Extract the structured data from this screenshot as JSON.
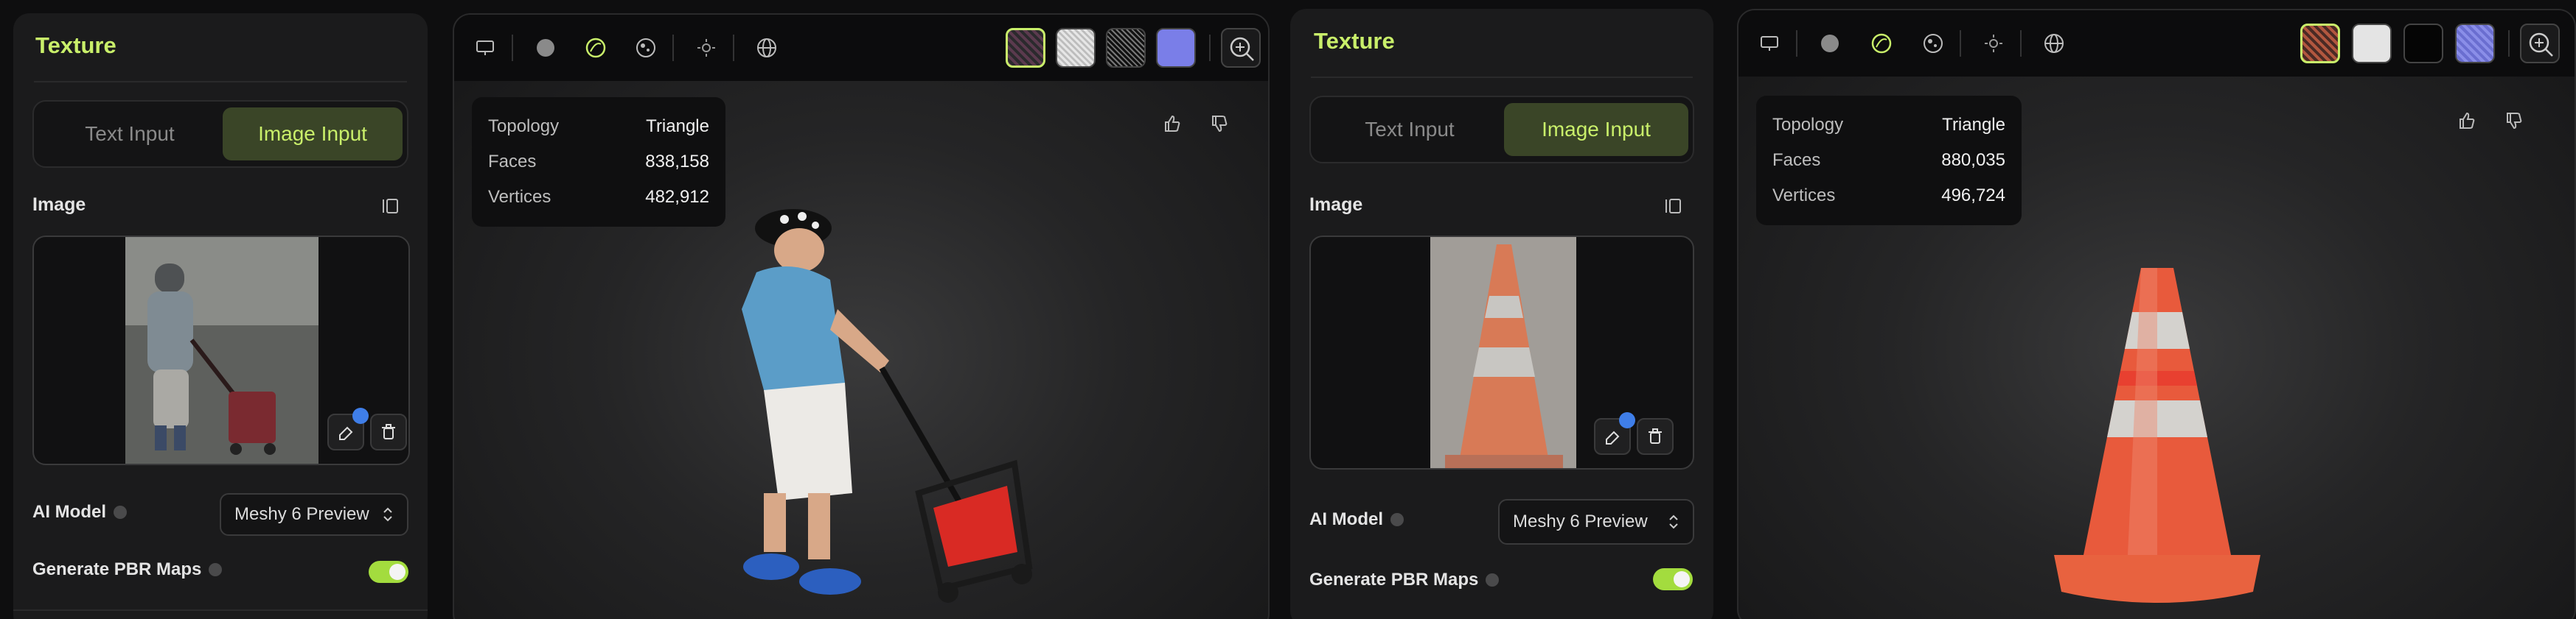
{
  "left_panel": {
    "title": "Texture",
    "tabs": [
      {
        "label": "Text Input"
      },
      {
        "label": "Image Input",
        "active": true
      }
    ],
    "image_label": "Image",
    "ai_model_label": "AI Model",
    "ai_model_value": "Meshy 6 Preview",
    "pbr_label": "Generate PBR Maps",
    "pbr_enabled": true
  },
  "left_viewer": {
    "stats": [
      {
        "key": "Topology",
        "value": "Triangle"
      },
      {
        "key": "Faces",
        "value": "838,158"
      },
      {
        "key": "Vertices",
        "value": "482,912"
      }
    ]
  },
  "right_panel": {
    "title": "Texture",
    "tabs": [
      {
        "label": "Text Input"
      },
      {
        "label": "Image Input",
        "active": true
      }
    ],
    "image_label": "Image",
    "ai_model_label": "AI Model",
    "ai_model_value": "Meshy 6 Preview",
    "pbr_label": "Generate PBR Maps",
    "pbr_enabled": true
  },
  "right_viewer": {
    "stats": [
      {
        "key": "Topology",
        "value": "Triangle"
      },
      {
        "key": "Faces",
        "value": "880,035"
      },
      {
        "key": "Vertices",
        "value": "496,724"
      }
    ]
  },
  "colors": {
    "accent": "#c9ef6a",
    "toggle_on": "#a3dc3e",
    "badge": "#3f7ee8"
  },
  "icons": [
    "monitor-icon",
    "solid-sphere-icon",
    "wireframe-sphere-icon",
    "texture-sphere-icon",
    "light-icon",
    "globe-icon",
    "zoom-icon",
    "thumbs-up-icon",
    "thumbs-down-icon",
    "eraser-icon",
    "trash-icon",
    "crop-icon",
    "chevron-updown-icon",
    "info-icon"
  ]
}
